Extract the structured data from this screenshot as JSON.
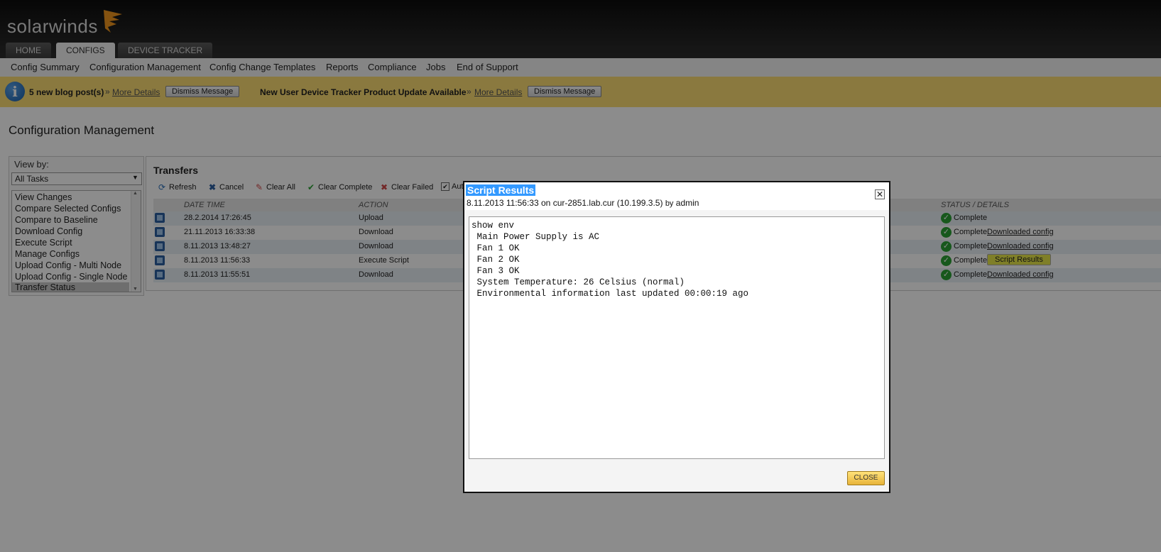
{
  "brand": {
    "logo_text": "solarwinds"
  },
  "tabs": [
    {
      "label": "HOME"
    },
    {
      "label": "CONFIGS",
      "active": true
    },
    {
      "label": "DEVICE TRACKER"
    }
  ],
  "subnav": [
    "Config Summary",
    "Configuration Management",
    "Config Change Templates",
    "Reports",
    "Compliance",
    "Jobs",
    "End of Support"
  ],
  "notifications": {
    "first_text": "5 new blog post(s)",
    "separator": "»",
    "link_label": "More Details",
    "dismiss_label": "Dismiss Message",
    "second_text": "New User Device Tracker Product Update Available"
  },
  "page_title": "Configuration Management",
  "sidebar": {
    "view_by_label": "View by:",
    "selected": "All Tasks",
    "tasks": [
      "View Changes",
      "Compare Selected Configs",
      "Compare to Baseline",
      "Download Config",
      "Execute Script",
      "Manage Configs",
      "Upload Config - Multi Node",
      "Upload Config - Single Node",
      "Transfer Status"
    ]
  },
  "transfers": {
    "title": "Transfers",
    "toolbar": {
      "refresh": "Refresh",
      "cancel": "Cancel",
      "clear_all": "Clear All",
      "clear_complete": "Clear Complete",
      "clear_failed": "Clear Failed",
      "auto_partial": "Aut"
    },
    "columns": {
      "date_time": "DATE TIME",
      "action": "ACTION",
      "status": "STATUS / DETAILS"
    },
    "rows": [
      {
        "date": "28.2.2014 17:26:45",
        "action": "Upload",
        "status": "Complete",
        "detail": ""
      },
      {
        "date": "21.11.2013 16:33:38",
        "action": "Download",
        "status": "Complete",
        "detail": "Downloaded config"
      },
      {
        "date": "8.11.2013 13:48:27",
        "action": "Download",
        "status": "Complete",
        "detail": "Downloaded config"
      },
      {
        "date": "8.11.2013 11:56:33",
        "action": "Execute Script",
        "status": "Complete",
        "detail": "Script Results"
      },
      {
        "date": "8.11.2013 11:55:51",
        "action": "Download",
        "status": "Complete",
        "detail": "Downloaded config"
      }
    ]
  },
  "modal": {
    "title": "Script Results",
    "subtitle_datetime": "8.11.2013 11:56:33",
    "subtitle_on": "on",
    "subtitle_node": "cur-2851.lab.cur (10.199.3.5)",
    "subtitle_by": "by",
    "subtitle_user": "admin",
    "output": "show env\n Main Power Supply is AC\n Fan 1 OK\n Fan 2 OK\n Fan 3 OK\n System Temperature: 26 Celsius (normal)\n Environmental information last updated 00:00:19 ago",
    "close_label": "CLOSE"
  },
  "colors": {
    "accent": "#fcdd74",
    "selection": "#3399ff",
    "success": "#2aa034"
  }
}
